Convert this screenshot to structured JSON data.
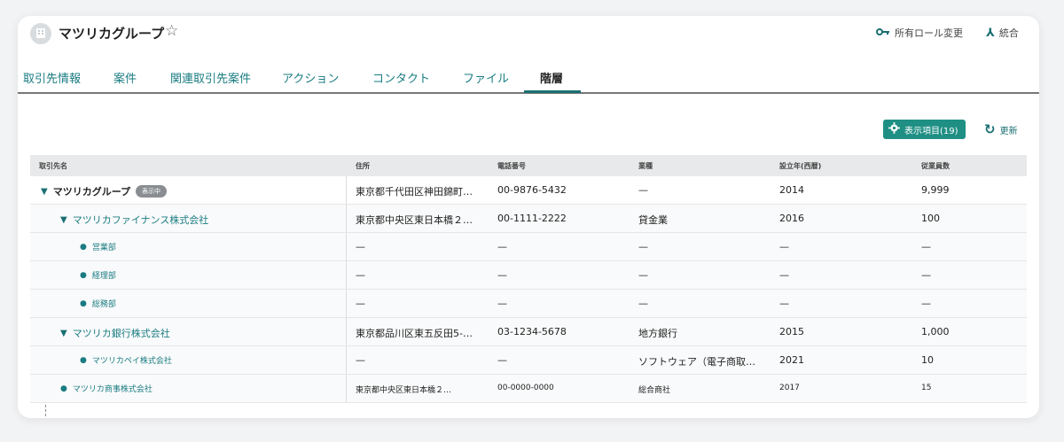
{
  "header": {
    "title": "マツリカグループ",
    "star_icon": "star-outline-icon",
    "actions": [
      {
        "label": "所有ロール変更",
        "icon": "key-icon"
      },
      {
        "label": "統合",
        "icon": "merge-icon"
      }
    ]
  },
  "tabs": [
    {
      "label": "取引先情報"
    },
    {
      "label": "案件"
    },
    {
      "label": "関連取引先案件"
    },
    {
      "label": "アクション"
    },
    {
      "label": "コンタクト"
    },
    {
      "label": "ファイル"
    },
    {
      "label": "階層",
      "active": true
    }
  ],
  "toolbar": {
    "columns_label": "表示項目(19)",
    "refresh_label": "更新"
  },
  "table": {
    "headers": [
      "取引先名",
      "住所",
      "電話番号",
      "業種",
      "設立年(西暦)",
      "従業員数"
    ],
    "rows": [
      {
        "name": "マツリカグループ",
        "badge": "表示中",
        "address": "東京都千代田区神田錦町…",
        "phone": "00-9876-5432",
        "industry": "—",
        "founded": "2014",
        "employees": "9,999"
      },
      {
        "name": "マツリカファイナンス株式会社",
        "address": "東京都中央区東日本橋２…",
        "phone": "00-1111-2222",
        "industry": "貸金業",
        "founded": "2016",
        "employees": "100"
      },
      {
        "name": "営業部",
        "address": "—",
        "phone": "—",
        "industry": "—",
        "founded": "—",
        "employees": "—"
      },
      {
        "name": "経理部",
        "address": "—",
        "phone": "—",
        "industry": "—",
        "founded": "—",
        "employees": "—"
      },
      {
        "name": "総務部",
        "address": "—",
        "phone": "—",
        "industry": "—",
        "founded": "—",
        "employees": "—"
      },
      {
        "name": "マツリカ銀行株式会社",
        "address": "東京都品川区東五反田5-…",
        "phone": "03-1234-5678",
        "industry": "地方銀行",
        "founded": "2015",
        "employees": "1,000"
      },
      {
        "name": "マツリカペイ株式会社",
        "address": "—",
        "phone": "—",
        "industry": "ソフトウェア（電子商取…",
        "founded": "2021",
        "employees": "10"
      },
      {
        "name": "マツリカ商事株式会社",
        "address": "東京都中央区東日本橋２…",
        "phone": "00-0000-0000",
        "industry": "総合商社",
        "founded": "2017",
        "employees": "15"
      }
    ]
  }
}
